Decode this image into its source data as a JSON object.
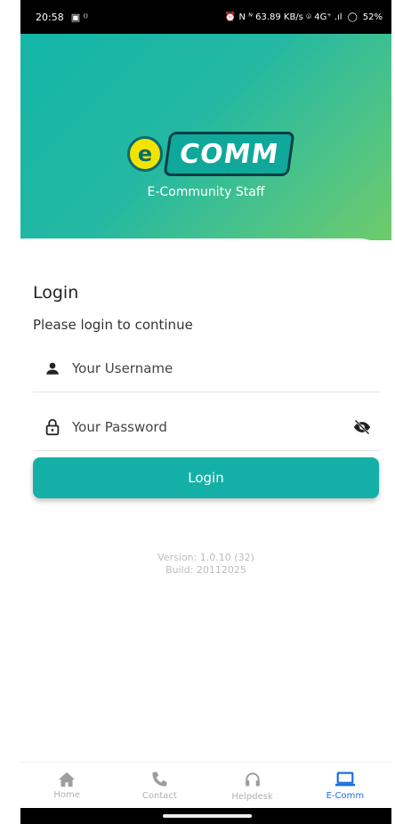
{
  "status_bar": {
    "time": "20:58",
    "right_text": "⏰ N ᴺ 63.89 KB/s ⌾ 4G⁺ .ıl",
    "battery": "52%"
  },
  "brand": {
    "logo_text": "COMM",
    "logo_letter": "e",
    "tagline": "E-Community Staff"
  },
  "login": {
    "title": "Login",
    "subtitle": "Please login to continue",
    "username_placeholder": "Your Username",
    "password_placeholder": "Your Password",
    "button_label": "Login"
  },
  "version": {
    "line1": "Version: 1.0.10 (32)",
    "line2": "Build: 20112025"
  },
  "tabs": [
    {
      "label": "Home",
      "icon": "home-icon",
      "active": false
    },
    {
      "label": "Contact",
      "icon": "phone-icon",
      "active": false
    },
    {
      "label": "Helpdesk",
      "icon": "headset-icon",
      "active": false
    },
    {
      "label": "E-Comm",
      "icon": "laptop-icon",
      "active": true
    }
  ],
  "colors": {
    "primary": "#14b0a8",
    "active_tab": "#1f6fe0"
  }
}
